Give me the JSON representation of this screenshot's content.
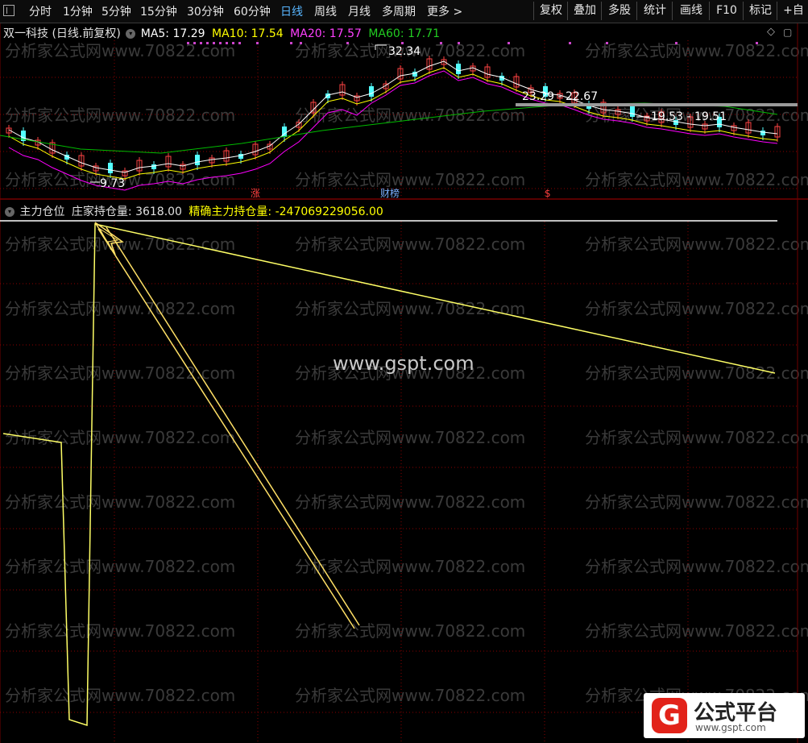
{
  "toolbar": {
    "periods": [
      "分时",
      "1分钟",
      "5分钟",
      "15分钟",
      "30分钟",
      "60分钟",
      "日线",
      "周线",
      "月线",
      "多周期",
      "更多 >"
    ],
    "active_period": "日线",
    "buttons": [
      "复权",
      "叠加",
      "多股",
      "统计",
      "画线",
      "F10",
      "标记",
      "+自"
    ]
  },
  "top_chart": {
    "stock_name": "双一科技",
    "period_label": "(日线.前复权)",
    "ma5_label": "MA5: 17.29",
    "ma10_label": "MA10: 17.54",
    "ma20_label": "MA20: 17.57",
    "ma60_label": "MA60: 17.71",
    "high_label": "32.34",
    "low_label": "9.73",
    "range_label_1": "23.29 - 22.67",
    "range_label_2": "19.53 - 19.51",
    "event_zhang": "涨",
    "event_caibang": "财榜",
    "event_dollar": "$",
    "colors": {
      "ma5": "#ffffff",
      "ma10": "#ffff00",
      "ma20": "#ff00ff",
      "ma60": "#00cc00",
      "up": "#ff4444",
      "down": "#54ffff"
    }
  },
  "bottom_chart": {
    "indicator_name": "主力仓位",
    "zhuang_label": "庄家持仓量: 3618.00",
    "jingque_label": "精确主力持仓量: -247069229056.00",
    "center_url": "www.gspt.com"
  },
  "watermark": "分析家公式网www.70822.com",
  "logo": {
    "mark": "G",
    "text": "公式平台",
    "url": "www.gspt.com"
  },
  "chart_data": {
    "type": "line",
    "series": [
      {
        "name": "MA5",
        "close_last": 17.29
      },
      {
        "name": "MA10",
        "close_last": 17.54
      },
      {
        "name": "MA20",
        "close_last": 17.57
      },
      {
        "name": "MA60",
        "close_last": 17.71
      }
    ],
    "annotations": [
      "32.34",
      "9.73",
      "23.29 - 22.67",
      "19.53 - 19.51"
    ]
  }
}
